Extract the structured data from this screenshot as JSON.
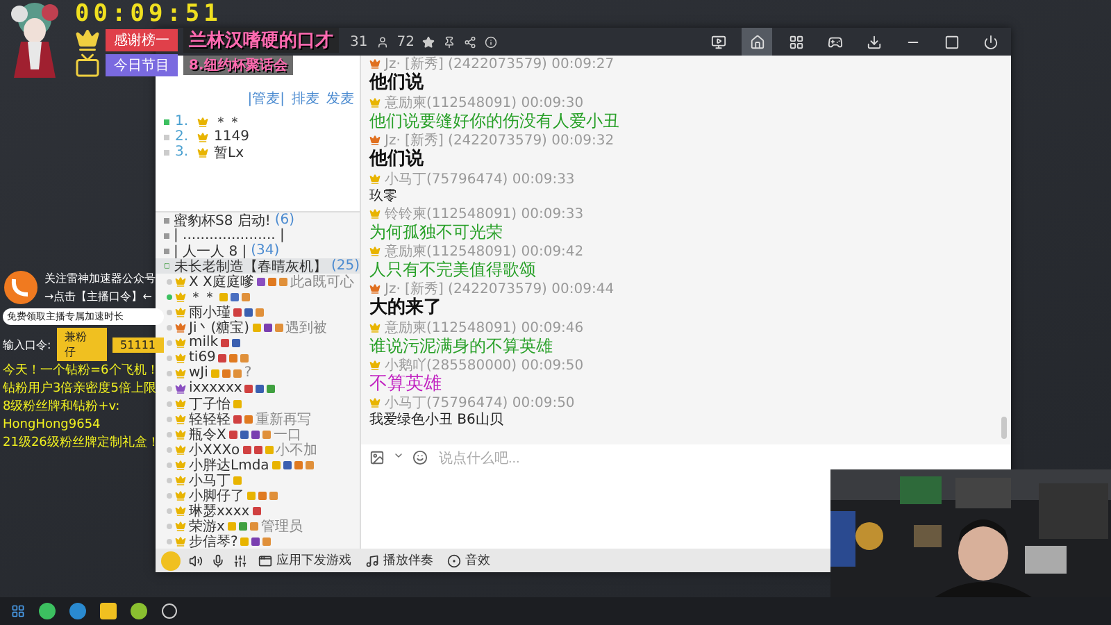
{
  "stream_overlay": {
    "timer": "00:09:51",
    "rows": [
      {
        "kind": "crown",
        "label": "感谢榜一",
        "value": "兰林汉嗜硬的口才"
      },
      {
        "kind": "tv",
        "label": "今日节目",
        "value": "8.纽约杯聚话会"
      }
    ]
  },
  "promo": {
    "title": "关注雷神加速器公众号",
    "action": "→点击【主播口令】←",
    "pill": "免费领取主播专属加速时长",
    "code_label": "输入口令:",
    "codes": [
      "兼粉仔",
      "51111"
    ],
    "lines": [
      "今天！一个钻粉=6个飞机！",
      "钻粉用户3倍亲密度5倍上限",
      "8级粉丝牌和钻粉+v:",
      "HongHong9654",
      "21级26级粉丝牌定制礼盒！"
    ]
  },
  "title_bar": {
    "online": "31",
    "users": "72",
    "nav": [
      {
        "kind": "video",
        "selected": false
      },
      {
        "kind": "home",
        "selected": true
      },
      {
        "kind": "grid",
        "selected": false
      },
      {
        "kind": "game",
        "selected": false
      },
      {
        "kind": "download",
        "selected": false
      },
      {
        "kind": "minimize",
        "selected": false
      },
      {
        "kind": "maximize",
        "selected": false
      },
      {
        "kind": "power",
        "selected": false
      }
    ]
  },
  "mic_queue": {
    "tabs": [
      "|管麦|",
      "排麦",
      "发麦"
    ],
    "entries": [
      {
        "rank": "1.",
        "name": "＊＊",
        "active": true
      },
      {
        "rank": "2.",
        "name": "1149",
        "active": false
      },
      {
        "rank": "3.",
        "name": "暂Lx",
        "active": false
      }
    ]
  },
  "channels": [
    {
      "name": "蜜豹杯S8 启动!",
      "count": "(6)",
      "selected": false
    },
    {
      "name": "| ..................... |",
      "selected": false
    },
    {
      "name": "|       人一人      8     |",
      "count": "(34)",
      "selected": false
    },
    {
      "name": "未长老制造【春晴灰机】",
      "count": "(25)",
      "selected": true
    }
  ],
  "users": [
    {
      "name": "X X庭庭嗲",
      "color": "#e8b400",
      "online": false,
      "badges": [
        {
          "color": "#8a4fc0"
        },
        {
          "color": "#e07a20"
        },
        {
          "color": "#e0903a"
        }
      ],
      "note": "此a既可心"
    },
    {
      "name": "＊＊",
      "color": "#e8b400",
      "online": true,
      "badges": [
        {
          "color": "#e8b400"
        },
        {
          "color": "#4a6fc0"
        },
        {
          "color": "#e0903a"
        }
      ]
    },
    {
      "name": "雨小瑾",
      "color": "#e8b400",
      "online": false,
      "badges": [
        {
          "color": "#d04040"
        },
        {
          "color": "#3a5fb0"
        },
        {
          "color": "#e0903a"
        }
      ]
    },
    {
      "name": "Ji丶(糖宝)",
      "color": "#e07020",
      "online": false,
      "badges": [
        {
          "color": "#e8b400"
        },
        {
          "color": "#7a3fb0"
        },
        {
          "color": "#e0903a"
        }
      ],
      "note": "遇到被"
    },
    {
      "name": "milk",
      "color": "#e8b400",
      "online": false,
      "badges": [
        {
          "color": "#d04040"
        },
        {
          "color": "#3a5fb0"
        }
      ]
    },
    {
      "name": "ti69",
      "color": "#e8b400",
      "online": false,
      "badges": [
        {
          "color": "#d04040"
        },
        {
          "color": "#e07a20"
        },
        {
          "color": "#e0903a"
        }
      ]
    },
    {
      "name": "wJi",
      "color": "#e8b400",
      "online": false,
      "badges": [
        {
          "color": "#e8b400"
        },
        {
          "color": "#e07a20"
        },
        {
          "color": "#e0903a"
        }
      ],
      "note": "?"
    },
    {
      "name": "ixxxxxx",
      "color": "#8a4fc0",
      "online": false,
      "badges": [
        {
          "color": "#d04040"
        },
        {
          "color": "#3a5fb0"
        },
        {
          "color": "#40a040"
        }
      ]
    },
    {
      "name": "丁子怡",
      "color": "#e8b400",
      "online": false,
      "badges": [
        {
          "color": "#e8b400"
        }
      ]
    },
    {
      "name": "轻轻轻",
      "color": "#e8b400",
      "online": false,
      "badges": [
        {
          "color": "#d04040"
        },
        {
          "color": "#e07a20"
        }
      ],
      "note": "重新再写"
    },
    {
      "name": "瓶令X",
      "color": "#e8b400",
      "online": false,
      "badges": [
        {
          "color": "#d04040"
        },
        {
          "color": "#3a5fb0"
        },
        {
          "color": "#7a3fb0"
        },
        {
          "color": "#e0903a"
        }
      ],
      "note": "一口"
    },
    {
      "name": "小XXXo",
      "color": "#e8b400",
      "online": false,
      "badges": [
        {
          "color": "#d04040"
        },
        {
          "color": "#d04040"
        },
        {
          "color": "#e8b400"
        }
      ],
      "note": "小不加"
    },
    {
      "name": "小胖达Lmda",
      "color": "#e8b400",
      "online": false,
      "badges": [
        {
          "color": "#e8b400"
        },
        {
          "color": "#3a5fb0"
        },
        {
          "color": "#e07a20"
        },
        {
          "color": "#e0903a"
        }
      ]
    },
    {
      "name": "小马丁",
      "color": "#e8b400",
      "online": false,
      "badges": [
        {
          "color": "#e8b400"
        }
      ]
    },
    {
      "name": "小脚仔了",
      "color": "#e8b400",
      "online": false,
      "badges": [
        {
          "color": "#e8b400"
        },
        {
          "color": "#e07a20"
        },
        {
          "color": "#e0903a"
        }
      ]
    },
    {
      "name": "琳瑟xxxx",
      "color": "#e8b400",
      "online": false,
      "badges": [
        {
          "color": "#d04040"
        }
      ]
    },
    {
      "name": "荣游x",
      "color": "#e8b400",
      "online": false,
      "badges": [
        {
          "color": "#e8b400"
        },
        {
          "color": "#40a040"
        },
        {
          "color": "#e0903a"
        }
      ],
      "note": "管理员"
    },
    {
      "name": "步信琴?",
      "color": "#e8b400",
      "online": false,
      "badges": [
        {
          "color": "#e8b400"
        },
        {
          "color": "#7a3fb0"
        },
        {
          "color": "#e0903a"
        }
      ]
    }
  ],
  "chat": {
    "messages": [
      {
        "color": "#e07020",
        "meta": "Jz·  [新秀] (2422073579) 00:09:27",
        "text": "他们说",
        "kind": "bold"
      },
      {
        "color": "#e8b400",
        "meta": "意励柬(112548091) 00:09:30",
        "text": "他们说要缝好你的伤没有人爱小丑",
        "kind": "green"
      },
      {
        "color": "#e07020",
        "meta": "Jz·  [新秀] (2422073579) 00:09:32",
        "text": "他们说",
        "kind": "bold"
      },
      {
        "color": "#e8b400",
        "meta": "小马丁(75796474) 00:09:33",
        "text": "玖零",
        "kind": "plain"
      },
      {
        "color": "#e8b400",
        "meta": "铃铃柬(112548091) 00:09:33",
        "text": "为何孤独不可光荣",
        "kind": "green"
      },
      {
        "color": "#e8b400",
        "meta": "意励柬(112548091) 00:09:42",
        "text": "人只有不完美值得歌颂",
        "kind": "green"
      },
      {
        "color": "#e07020",
        "meta": "Jz·  [新秀] (2422073579) 00:09:44",
        "text": "大的来了",
        "kind": "bold"
      },
      {
        "color": "#e8b400",
        "meta": "意励柬(112548091) 00:09:46",
        "text": "谁说污泥满身的不算英雄",
        "kind": "green"
      },
      {
        "color": "#e8b400",
        "meta": "小鹅吖(285580000) 00:09:50",
        "text": "不算英雄",
        "kind": "magenta"
      },
      {
        "color": "#e8b400",
        "meta": "小马丁(75796474) 00:09:50",
        "text": "我爱绿色小丑 B6山贝",
        "kind": "plain"
      }
    ]
  },
  "input": {
    "placeholder": "说点什么吧..."
  },
  "toolbar": {
    "items": [
      {
        "kind": "app",
        "label": "应用下发游戏"
      },
      {
        "kind": "music",
        "label": "播放伴奏"
      }
    ],
    "effects": "音效"
  }
}
